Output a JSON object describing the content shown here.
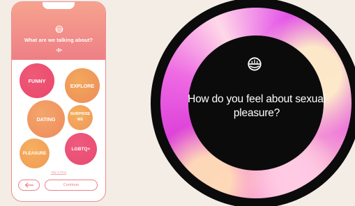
{
  "phone": {
    "prompt": "What are we talking about?",
    "topics": [
      {
        "label": "FUNNY"
      },
      {
        "label": "EXPLORE"
      },
      {
        "label": "DATING"
      },
      {
        "label": "SURPRISE ME"
      },
      {
        "label": "PLEASURE"
      },
      {
        "label": "LGBTQ+"
      }
    ],
    "skip_label": "Skip it Plus",
    "continue_label": "Continue",
    "icons": {
      "logo": "helmet-logo-icon",
      "audio": "audio-wave-icon",
      "back": "arrow-left-icon"
    }
  },
  "display": {
    "question": "How do you feel about sexual pleasure?",
    "icons": {
      "logo": "helmet-logo-icon"
    }
  },
  "colors": {
    "background": "#f3ede6",
    "coral": "#ee7f85",
    "pink": "#e9476a",
    "orange": "#f09a55",
    "magenta": "#d63fe0"
  }
}
